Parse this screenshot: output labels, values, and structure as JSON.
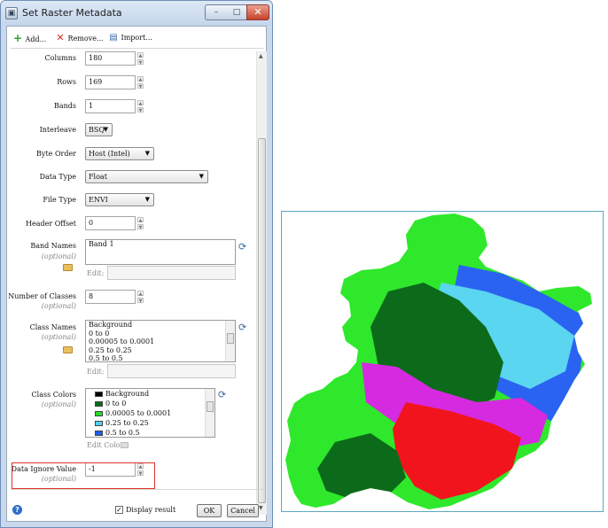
{
  "window": {
    "title": "Set Raster Metadata",
    "min_glyph": "–",
    "max_glyph": "□",
    "close_glyph": "✕"
  },
  "toolbar": {
    "add_label": "Add...",
    "remove_label": "Remove...",
    "import_label": "Import..."
  },
  "form": {
    "columns": {
      "label": "Columns",
      "value": "180"
    },
    "rows": {
      "label": "Rows",
      "value": "169"
    },
    "bands": {
      "label": "Bands",
      "value": "1"
    },
    "interleave": {
      "label": "Interleave",
      "value": "BSQ"
    },
    "byte_order": {
      "label": "Byte Order",
      "value": "Host (Intel)"
    },
    "data_type": {
      "label": "Data Type",
      "value": "Float"
    },
    "file_type": {
      "label": "File Type",
      "value": "ENVI"
    },
    "header_offset": {
      "label": "Header Offset",
      "value": "0"
    },
    "band_names": {
      "label": "Band Names",
      "optional": "(optional)",
      "items": [
        "Band 1"
      ],
      "edit_label": "Edit:"
    },
    "num_classes": {
      "label": "Number of Classes",
      "optional": "(optional)",
      "value": "8"
    },
    "class_names": {
      "label": "Class Names",
      "optional": "(optional)",
      "items": [
        "Background",
        "0 to 0",
        "0.00005 to 0.0001",
        "0.25 to 0.25",
        "0.5 to 0.5"
      ],
      "edit_label": "Edit:"
    },
    "class_colors": {
      "label": "Class Colors",
      "optional": "(optional)",
      "items": [
        {
          "name": "Background",
          "color": "#000000"
        },
        {
          "name": "0 to 0",
          "color": "#0a6b17"
        },
        {
          "name": "0.00005 to 0.0001",
          "color": "#22e01e"
        },
        {
          "name": "0.25 to 0.25",
          "color": "#52d2ec"
        },
        {
          "name": "0.5 to 0.5",
          "color": "#1f5ff0"
        }
      ],
      "edit_label": "Edit Color:"
    },
    "data_ignore": {
      "label": "Data Ignore Value",
      "optional": "(optional)",
      "value": "-1"
    }
  },
  "footer": {
    "display_result_label": "Display result",
    "display_result_checked": true,
    "ok_label": "OK",
    "cancel_label": "Cancel"
  },
  "map": {
    "background_color": "#ffffff",
    "frame_color": "#5aa8c0",
    "class_colors": {
      "green_light": "#2fe82c",
      "green_dark": "#0c6b1a",
      "cyan": "#5ad6f0",
      "blue": "#2a63f2",
      "magenta": "#d62ae0",
      "red": "#f2141c"
    }
  }
}
